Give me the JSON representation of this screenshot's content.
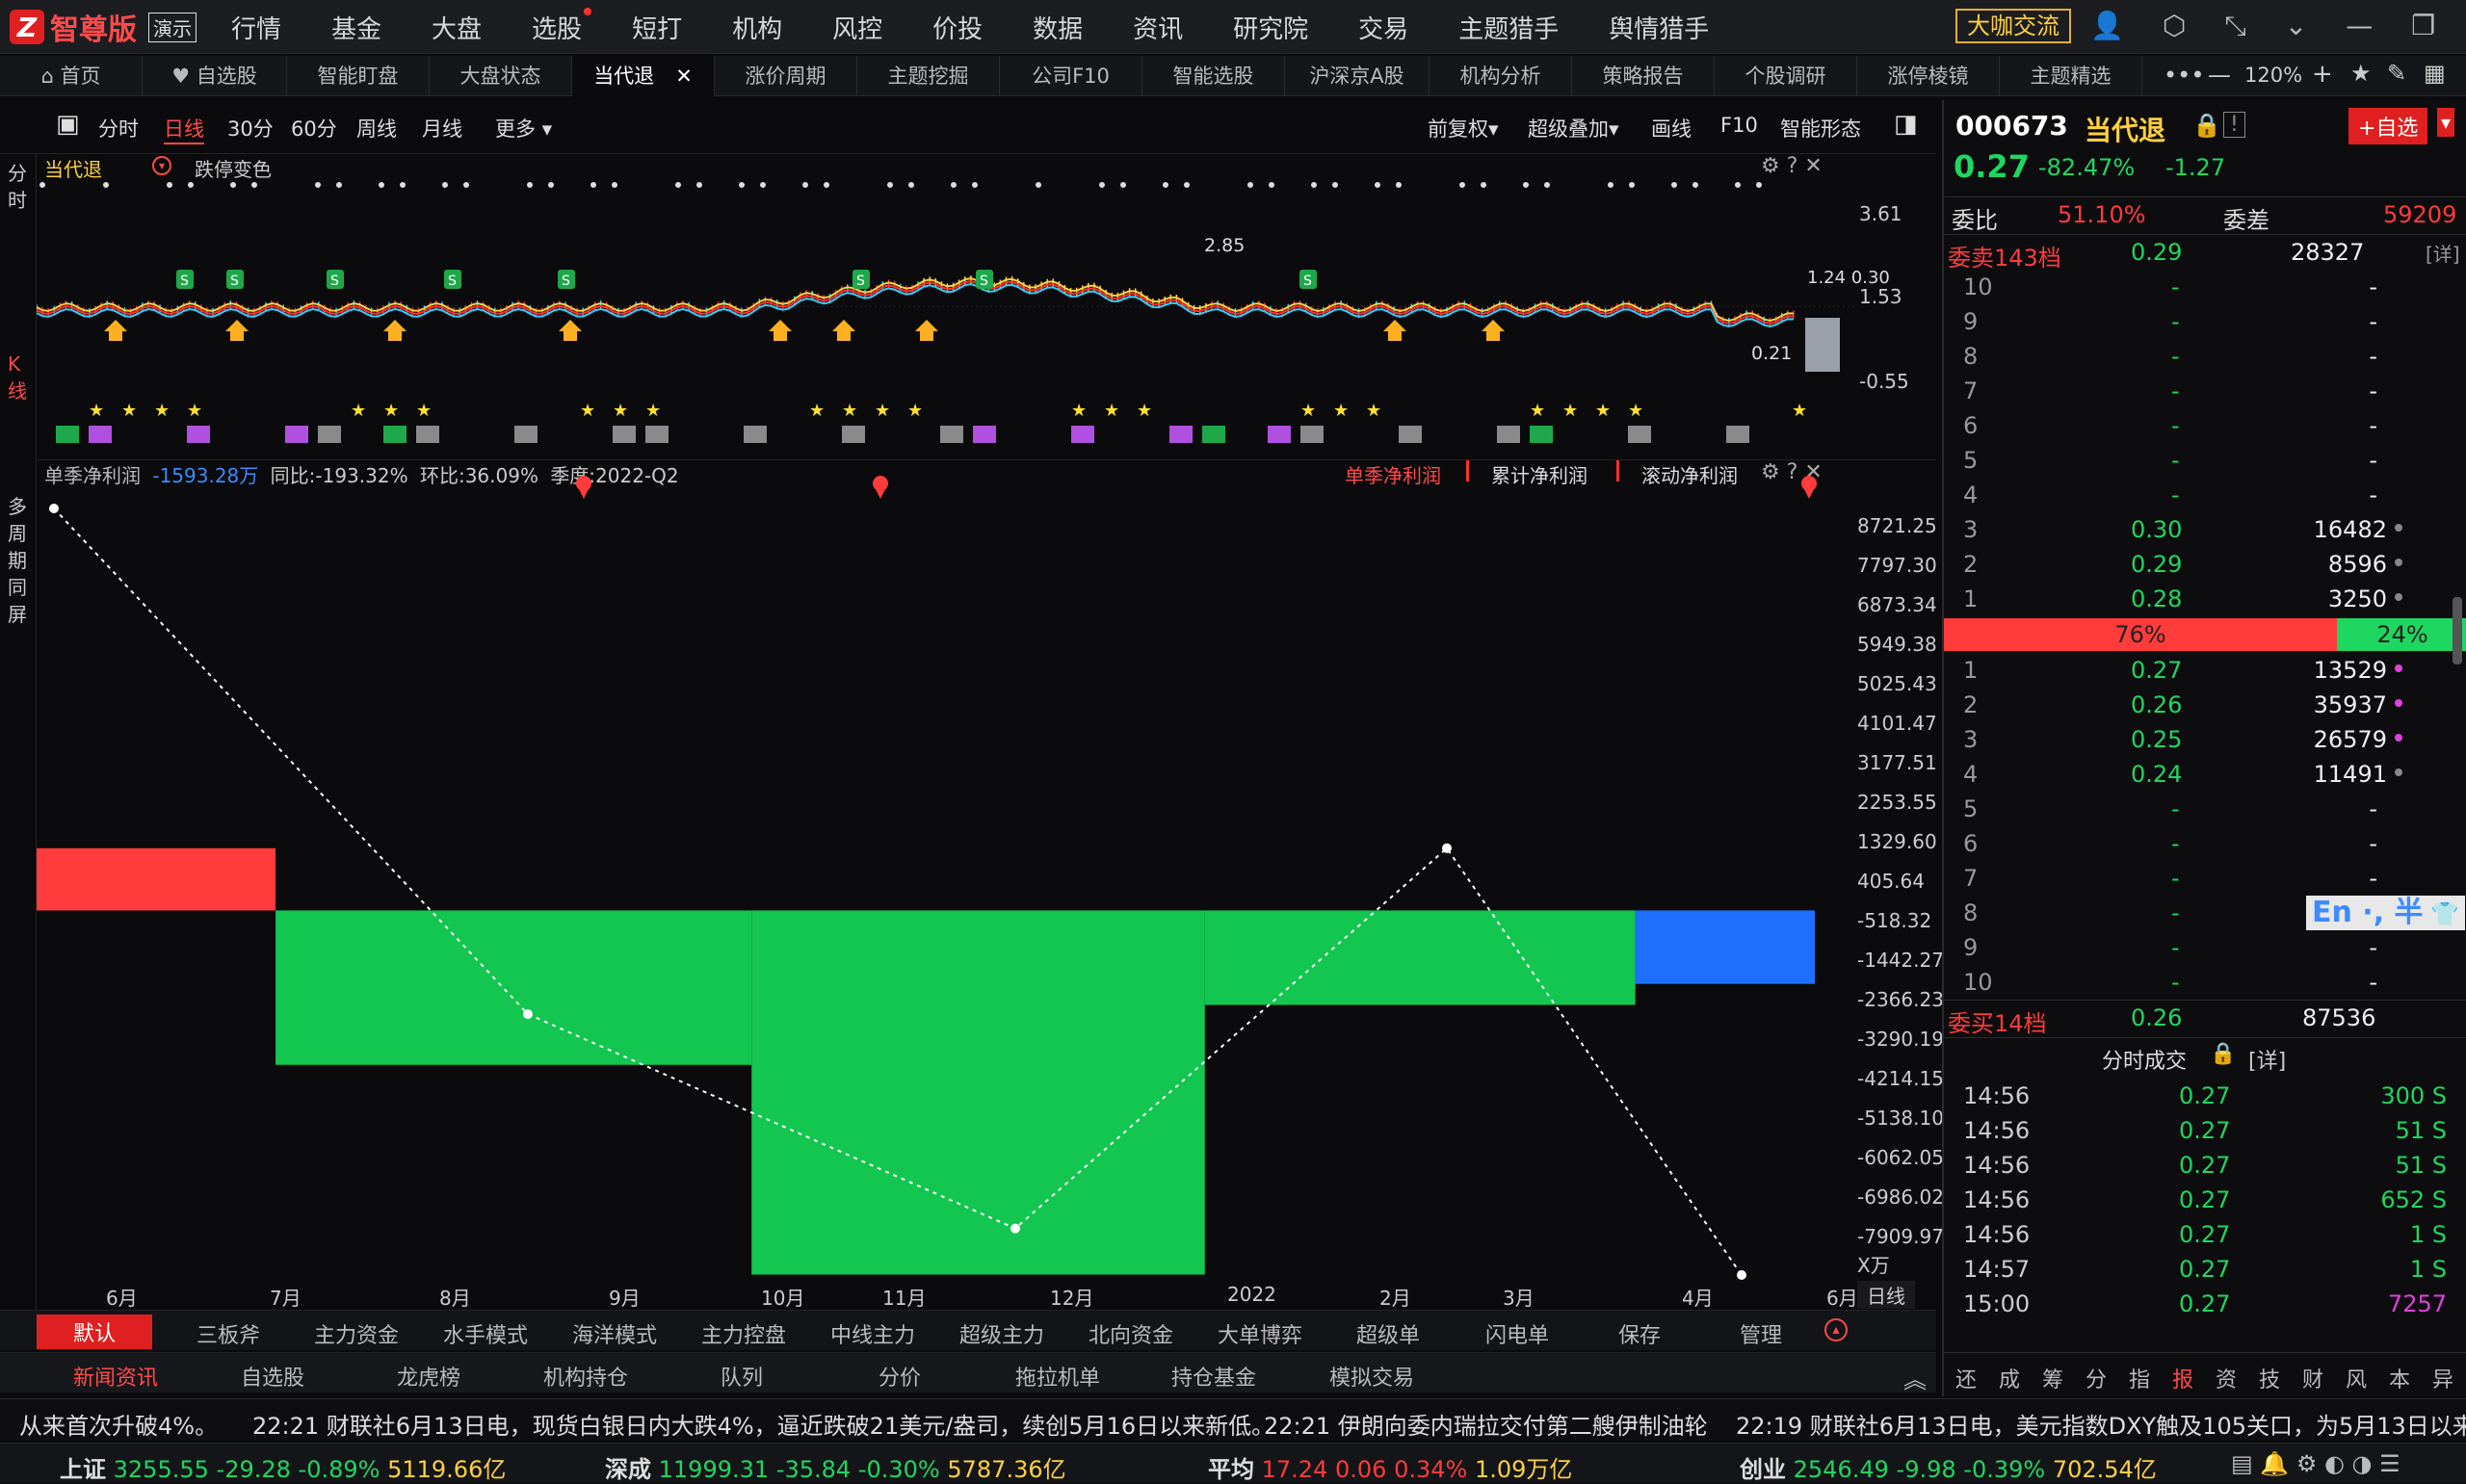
{
  "app": {
    "name": "智尊版",
    "badge": "演示"
  },
  "main_menu": [
    "行情",
    "基金",
    "大盘",
    "选股",
    "短打",
    "机构",
    "风控",
    "价投",
    "数据",
    "资讯",
    "研究院",
    "交易",
    "主题猎手",
    "舆情猎手"
  ],
  "daka_button": "大咖交流",
  "tabs": [
    "首页",
    "自选股",
    "智能盯盘",
    "大盘状态",
    "当代退",
    "涨价周期",
    "主题挖掘",
    "公司F10",
    "智能选股",
    "沪深京A股",
    "机构分析",
    "策略报告",
    "个股调研",
    "涨停棱镜",
    "主题精选"
  ],
  "zoom": "120%",
  "toolbar": {
    "left": [
      "分时",
      "日线",
      "30分",
      "60分",
      "周线",
      "月线",
      "更多"
    ],
    "right": [
      "前复权",
      "超级叠加",
      "画线",
      "F10",
      "智能形态"
    ]
  },
  "left_strip": {
    "top": "分时",
    "mid": "K线",
    "bottom": "多周期同屏"
  },
  "kpanel": {
    "title": "当代退",
    "subtitle": "跌停变色",
    "axis": [
      "3.61",
      "1.53",
      "-0.55"
    ],
    "labels": {
      "high": "2.85",
      "low": "0.21",
      "last": "1.24 0.30"
    }
  },
  "fpanel": {
    "header": {
      "label": "单季净利润",
      "value": "-1593.28万",
      "yoy": "同比:-193.32%",
      "qoq": "环比:36.09%",
      "quarter": "季度:2022-Q2"
    },
    "tabs": [
      "单季净利润",
      "累计净利润",
      "滚动净利润"
    ],
    "yaxis": [
      "8721.25",
      "7797.30",
      "6873.34",
      "5949.38",
      "5025.43",
      "4101.47",
      "3177.51",
      "2253.55",
      "1329.60",
      "405.64",
      "-518.32",
      "-1442.27",
      "-2366.23",
      "-3290.19",
      "-4214.15",
      "-5138.10",
      "-6062.05",
      "-6986.02",
      "-7909.97"
    ],
    "unit": "X万",
    "xaxis": [
      "6月",
      "7月",
      "8月",
      "9月",
      "10月",
      "11月",
      "12月",
      "2022",
      "2月",
      "3月",
      "4月",
      "6月"
    ],
    "period_label": "日线"
  },
  "chart_data": {
    "type": "bar",
    "title": "单季净利润",
    "ylabel": "",
    "ylim": [
      -7909.97,
      8721.25
    ],
    "series": [
      {
        "name": "单季净利润",
        "values": [
          1350,
          -3350,
          -7900,
          -2050,
          -1593.28
        ]
      },
      {
        "name": "dotted",
        "values": [
          8721.25,
          -2250,
          -6900,
          1350,
          -7909.97
        ]
      }
    ]
  },
  "bottom_tabs1": [
    "默认",
    "三板斧",
    "主力资金",
    "水手模式",
    "海洋模式",
    "主力控盘",
    "中线主力",
    "超级主力",
    "北向资金",
    "大单博弈",
    "超级单",
    "闪电单",
    "保存",
    "管理"
  ],
  "bottom_tabs2": [
    "新闻资讯",
    "自选股",
    "龙虎榜",
    "机构持仓",
    "队列",
    "分价",
    "拖拉机单",
    "持仓基金",
    "模拟交易"
  ],
  "ticker": [
    "从来首次升破4%。",
    "22:21 财联社6月13日电，现货白银日内大跌4%，逼近跌破21美元/盎司，续创5月16日以来新低。",
    "22:21 伊朗向委内瑞拉交付第二艘伊制油轮",
    "22:19 财联社6月13日电，美元指数DXY触及105关口，为5月13日以来首"
  ],
  "indices": [
    {
      "name": "上证",
      "value": "3255.55",
      "chg": "-29.28",
      "pct": "-0.89%",
      "amt": "5119.66亿"
    },
    {
      "name": "深成",
      "value": "11999.31",
      "chg": "-35.84",
      "pct": "-0.30%",
      "amt": "5787.36亿"
    },
    {
      "name": "平均",
      "value": "17.24",
      "chg": "0.06",
      "pct": "0.34%",
      "amt": "1.09万亿"
    },
    {
      "name": "创业",
      "value": "2546.49",
      "chg": "-9.98",
      "pct": "-0.39%",
      "amt": "702.54亿"
    }
  ],
  "stock": {
    "code": "000673",
    "name": "当代退",
    "price": "0.27",
    "pct": "-82.47%",
    "chg": "-1.27",
    "add_btn": "+自选"
  },
  "weibi": {
    "label": "委比",
    "value": "51.10%",
    "diff_label": "委差",
    "diff": "59209"
  },
  "sell_header": {
    "label": "委卖143档",
    "price": "0.29",
    "vol": "28327",
    "more": "[详]"
  },
  "sell_rows": [
    {
      "n": "10",
      "p": "-",
      "v": "-"
    },
    {
      "n": "9",
      "p": "-",
      "v": "-"
    },
    {
      "n": "8",
      "p": "-",
      "v": "-"
    },
    {
      "n": "7",
      "p": "-",
      "v": "-"
    },
    {
      "n": "6",
      "p": "-",
      "v": "-"
    },
    {
      "n": "5",
      "p": "-",
      "v": "-"
    },
    {
      "n": "4",
      "p": "-",
      "v": "-"
    },
    {
      "n": "3",
      "p": "0.30",
      "v": "16482"
    },
    {
      "n": "2",
      "p": "0.29",
      "v": "8596"
    },
    {
      "n": "1",
      "p": "0.28",
      "v": "3250"
    }
  ],
  "ratio": {
    "buy": "76%",
    "sell": "24%"
  },
  "buy_rows": [
    {
      "n": "1",
      "p": "0.27",
      "v": "13529"
    },
    {
      "n": "2",
      "p": "0.26",
      "v": "35937"
    },
    {
      "n": "3",
      "p": "0.25",
      "v": "26579"
    },
    {
      "n": "4",
      "p": "0.24",
      "v": "11491"
    },
    {
      "n": "5",
      "p": "-",
      "v": "-"
    },
    {
      "n": "6",
      "p": "-",
      "v": "-"
    },
    {
      "n": "7",
      "p": "-",
      "v": "-"
    },
    {
      "n": "8",
      "p": "-",
      "v": "-"
    },
    {
      "n": "9",
      "p": "-",
      "v": "-"
    },
    {
      "n": "10",
      "p": "-",
      "v": "-"
    }
  ],
  "buy_header": {
    "label": "委买14档",
    "price": "0.26",
    "vol": "87536"
  },
  "ime": "En ·, 半",
  "trades_header": {
    "label": "分时成交",
    "more": "[详]"
  },
  "trades": [
    {
      "t": "14:56",
      "p": "0.27",
      "v": "300 S"
    },
    {
      "t": "14:56",
      "p": "0.27",
      "v": "51 S"
    },
    {
      "t": "14:56",
      "p": "0.27",
      "v": "51 S"
    },
    {
      "t": "14:56",
      "p": "0.27",
      "v": "652 S"
    },
    {
      "t": "14:56",
      "p": "0.27",
      "v": "1 S"
    },
    {
      "t": "14:57",
      "p": "0.27",
      "v": "1 S"
    },
    {
      "t": "15:00",
      "p": "0.27",
      "v": "7257"
    }
  ],
  "right_tabs": [
    "还",
    "成",
    "筹",
    "分",
    "指",
    "报",
    "资",
    "技",
    "财",
    "风",
    "本",
    "异"
  ]
}
